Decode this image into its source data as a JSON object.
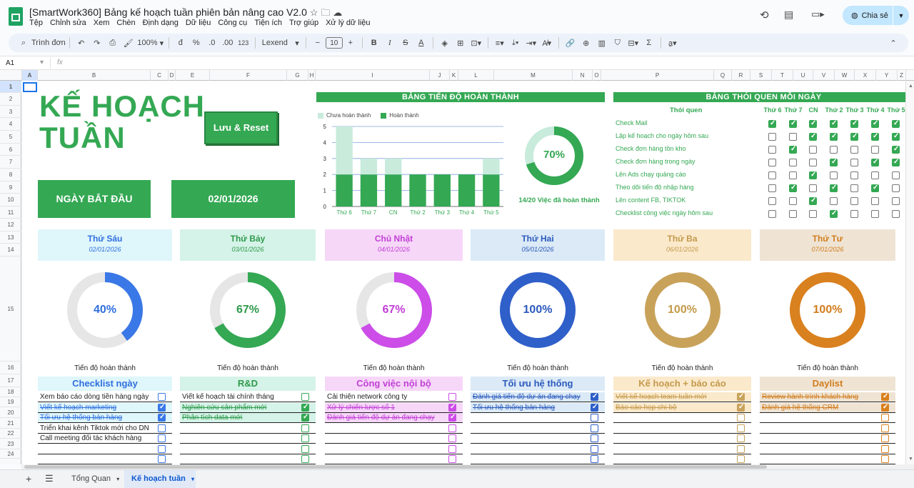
{
  "doc": {
    "title": "[SmartWork360] Bảng kế hoạch tuần phiên bản nâng cao V2.0"
  },
  "menu": [
    "Tệp",
    "Chỉnh sửa",
    "Xem",
    "Chèn",
    "Định dạng",
    "Dữ liệu",
    "Công cụ",
    "Tiện ích",
    "Trợ giúp",
    "Xử lý dữ liệu"
  ],
  "share": {
    "label": "Chia sẻ"
  },
  "toolbar": {
    "search": "Trình đơn",
    "zoom": "100%",
    "currency": "đ",
    "percent": "%",
    "dec_dec": ".0",
    "dec_inc": ".00",
    "num_format": "123",
    "font": "Lexend",
    "font_size": "10"
  },
  "formula": {
    "cell_ref": "A1",
    "fx": "fx"
  },
  "columns": [
    "A",
    "B",
    "C",
    "D",
    "E",
    "F",
    "G",
    "H",
    "I",
    "J",
    "K",
    "L",
    "M",
    "N",
    "O",
    "P",
    "Q",
    "R",
    "S",
    "T",
    "U",
    "V",
    "W",
    "X",
    "Y",
    "Z"
  ],
  "rows": [
    "1",
    "2",
    "3",
    "4",
    "5",
    "6",
    "7",
    "8",
    "9",
    "10",
    "11",
    "12",
    "13",
    "14",
    "15",
    "16",
    "17",
    "18",
    "19",
    "20",
    "21",
    "22",
    "23",
    "24"
  ],
  "plan": {
    "title_line1": "KẾ HOẠCH",
    "title_line2": "TUẦN",
    "save_reset": "Lưu & Reset",
    "start_label": "NGÀY BẮT ĐẦU",
    "start_date": "02/01/2026"
  },
  "progress": {
    "title": "BẢNG TIẾN ĐỘ HOÀN THÀNH",
    "legend_incomplete": "Chưa hoàn thành",
    "legend_complete": "Hoàn thành",
    "percent": "70%",
    "summary": "14/20 Việc đã hoàn thành",
    "colors": {
      "done": "#34a853",
      "todo": "#c8ebdc"
    }
  },
  "chart_data": {
    "type": "bar",
    "categories": [
      "Thứ 6",
      "Thứ 7",
      "CN",
      "Thứ 2",
      "Thứ 3",
      "Thứ 4",
      "Thứ 5"
    ],
    "series": [
      {
        "name": "Hoàn thành",
        "values": [
          2,
          2,
          2,
          2,
          2,
          2,
          2
        ]
      },
      {
        "name": "Chưa hoàn thành",
        "values": [
          3,
          1,
          1,
          0,
          0,
          0,
          1
        ]
      }
    ],
    "stacked": true,
    "ylim": [
      0,
      5
    ],
    "yticks": [
      "0",
      "1",
      "2",
      "3",
      "4",
      "5"
    ],
    "legend": "top-left",
    "grid": true
  },
  "habits": {
    "title": "BẢNG THÓI QUEN MỖI NGÀY",
    "col_header": "Thói quen",
    "days": [
      "Thứ 6",
      "Thứ 7",
      "CN",
      "Thứ 2",
      "Thứ 3",
      "Thứ 4",
      "Thứ 5"
    ],
    "items": [
      {
        "name": "Check Mail",
        "checks": [
          true,
          true,
          true,
          true,
          true,
          true,
          true
        ]
      },
      {
        "name": "Lập kế hoạch cho ngày hôm sau",
        "checks": [
          false,
          false,
          true,
          true,
          true,
          true,
          true
        ]
      },
      {
        "name": "Check đơn hàng tồn kho",
        "checks": [
          false,
          true,
          false,
          false,
          false,
          false,
          true
        ]
      },
      {
        "name": "Check đơn hàng trong ngày",
        "checks": [
          false,
          false,
          false,
          true,
          false,
          true,
          true
        ]
      },
      {
        "name": "Lên Ads chạy quảng cáo",
        "checks": [
          false,
          false,
          true,
          false,
          false,
          false,
          false
        ]
      },
      {
        "name": "Theo dõi tiến độ nhập hàng",
        "checks": [
          false,
          true,
          false,
          true,
          false,
          true,
          false
        ]
      },
      {
        "name": "Lên content FB, TIKTOK",
        "checks": [
          false,
          false,
          true,
          false,
          false,
          false,
          false
        ]
      },
      {
        "name": "Checklist công việc ngày hôm sau",
        "checks": [
          false,
          false,
          false,
          true,
          false,
          false,
          false
        ]
      }
    ]
  },
  "progress_caption": "Tiến độ hoàn thành",
  "days": [
    {
      "name": "Thứ Sáu",
      "date": "02/01/2026",
      "percent_label": "40%",
      "fraction": 0.4,
      "color": "#3b78e7",
      "bg": "#dff6fb",
      "text": "#2f6fdf",
      "track": "#e6e6e6",
      "list_title": "Checklist ngày",
      "list_bg": "#dff6fb",
      "list_text": "#2f6fdf",
      "tasks": [
        {
          "t": "Xem báo cáo dòng tiền hàng ngày",
          "done": false
        },
        {
          "t": "Viết kế hoạch marketing",
          "done": true
        },
        {
          "t": "Tối ưu hệ thống bán hàng",
          "done": true
        },
        {
          "t": "Triển khai kênh Tiktok mới cho DN",
          "done": false
        },
        {
          "t": "Call meeting đối tác khách hàng",
          "done": false
        }
      ]
    },
    {
      "name": "Thứ Bảy",
      "date": "03/01/2026",
      "percent_label": "67%",
      "fraction": 0.67,
      "color": "#34a853",
      "bg": "#d5f3e8",
      "text": "#2e9a4b",
      "track": "#e6e6e6",
      "list_title": "R&D",
      "list_bg": "#d5f3e8",
      "list_text": "#2e9a4b",
      "tasks": [
        {
          "t": "Viết kế hoạch tài chính tháng",
          "done": false
        },
        {
          "t": "Nghiên cứu sản phẩm mới",
          "done": true
        },
        {
          "t": "Phân tích data mới",
          "done": true
        }
      ]
    },
    {
      "name": "Chủ Nhật",
      "date": "04/01/2026",
      "percent_label": "67%",
      "fraction": 0.67,
      "color": "#cc4de8",
      "bg": "#f6d7f8",
      "text": "#c23ed6",
      "track": "#e6e6e6",
      "list_title": "Công việc nội bộ",
      "list_bg": "#f6d7f8",
      "list_text": "#c23ed6",
      "tasks": [
        {
          "t": "Cải thiện network công ty",
          "done": false
        },
        {
          "t": "Xử lý chiến lược số 1",
          "done": true
        },
        {
          "t": "Đánh giá tiến độ dự án đang chạy",
          "done": true
        }
      ]
    },
    {
      "name": "Thứ Hai",
      "date": "05/01/2026",
      "percent_label": "100%",
      "fraction": 1.0,
      "color": "#2f5fc9",
      "bg": "#dbeaf6",
      "text": "#2b59bd",
      "track": "#e6e6e6",
      "list_title": "Tối ưu hệ thống",
      "list_bg": "#dbeaf6",
      "list_text": "#2b59bd",
      "tasks": [
        {
          "t": "Đánh giá tiến độ dự án đang chạy",
          "done": true
        },
        {
          "t": "Tối ưu hệ thống bán hàng",
          "done": true
        }
      ]
    },
    {
      "name": "Thứ Ba",
      "date": "06/01/2026",
      "percent_label": "100%",
      "fraction": 1.0,
      "color": "#c9a25a",
      "bg": "#fbe9cc",
      "text": "#c39a4b",
      "track": "#e6e6e6",
      "list_title": "Kế hoạch + báo cáo",
      "list_bg": "#fbe9cc",
      "list_text": "#c39a4b",
      "tasks": [
        {
          "t": "Viết kế hoạch team tuần mới",
          "done": true
        },
        {
          "t": "Báo cáo họp chi bộ",
          "done": true
        }
      ]
    },
    {
      "name": "Thứ Tư",
      "date": "07/01/2026",
      "percent_label": "100%",
      "fraction": 1.0,
      "color": "#d9811e",
      "bg": "#efe4d4",
      "text": "#d17c1c",
      "track": "#e6e6e6",
      "list_title": "Daylist",
      "list_bg": "#efe4d4",
      "list_text": "#d17c1c",
      "tasks": [
        {
          "t": "Review hành trình khách hàng",
          "done": true
        },
        {
          "t": "Đánh giá hệ thống CRM",
          "done": true
        }
      ]
    }
  ],
  "tabs": [
    {
      "label": "Tổng Quan",
      "active": false
    },
    {
      "label": "Kế hoạch tuần",
      "active": true
    }
  ]
}
